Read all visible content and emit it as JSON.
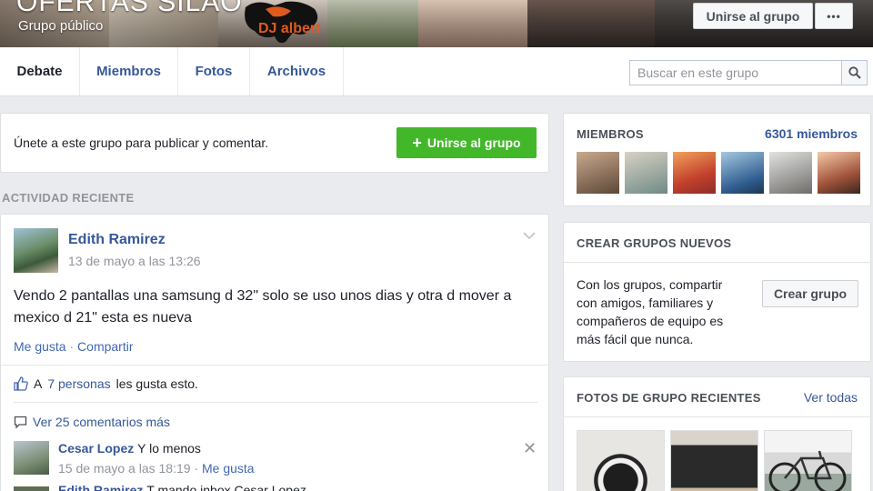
{
  "header": {
    "group_name": "OFERTAS SILAO",
    "group_type": "Grupo público",
    "logo_text": "DJ albert",
    "join_button": "Unirse al grupo",
    "more_button": "•••"
  },
  "tabs": [
    {
      "label": "Debate",
      "active": true
    },
    {
      "label": "Miembros",
      "active": false
    },
    {
      "label": "Fotos",
      "active": false
    },
    {
      "label": "Archivos",
      "active": false
    }
  ],
  "search": {
    "placeholder": "Buscar en este grupo",
    "value": ""
  },
  "join_prompt": {
    "text": "Únete a este grupo para publicar y comentar.",
    "button": "Unirse al grupo"
  },
  "recent_activity_label": "ACTIVIDAD RECIENTE",
  "post": {
    "author": "Edith Ramirez",
    "time": "13 de mayo a las 13:26",
    "text": "Vendo 2 pantallas una samsung d 32\" solo se uso unos dias y otra d mover a mexico d 21\" esta es nueva",
    "like_action": "Me gusta",
    "separator": "·",
    "share_action": "Compartir",
    "likes_prefix": "A",
    "likes_link": "7 personas",
    "likes_suffix": "les gusta esto.",
    "more_comments": "Ver 25 comentarios más",
    "comments": [
      {
        "author": "Cesar Lopez",
        "text": "Y lo menos",
        "time": "15 de mayo a las 18:19",
        "separator": "·",
        "like_action": "Me gusta"
      },
      {
        "author": "Edith Ramirez",
        "text": "T mando inbox Cesar Lopez"
      }
    ]
  },
  "members": {
    "title": "MIEMBROS",
    "count": "6301 miembros"
  },
  "create_groups": {
    "title": "CREAR GRUPOS NUEVOS",
    "text": "Con los grupos, compartir con amigos, familiares y compañeros de equipo es más fácil que nunca.",
    "button": "Crear grupo"
  },
  "recent_photos": {
    "title": "FOTOS DE GRUPO RECIENTES",
    "see_all": "Ver todas"
  },
  "colors": {
    "link": "#365899",
    "green_button": "#42b72a",
    "background": "#e9ebee"
  }
}
